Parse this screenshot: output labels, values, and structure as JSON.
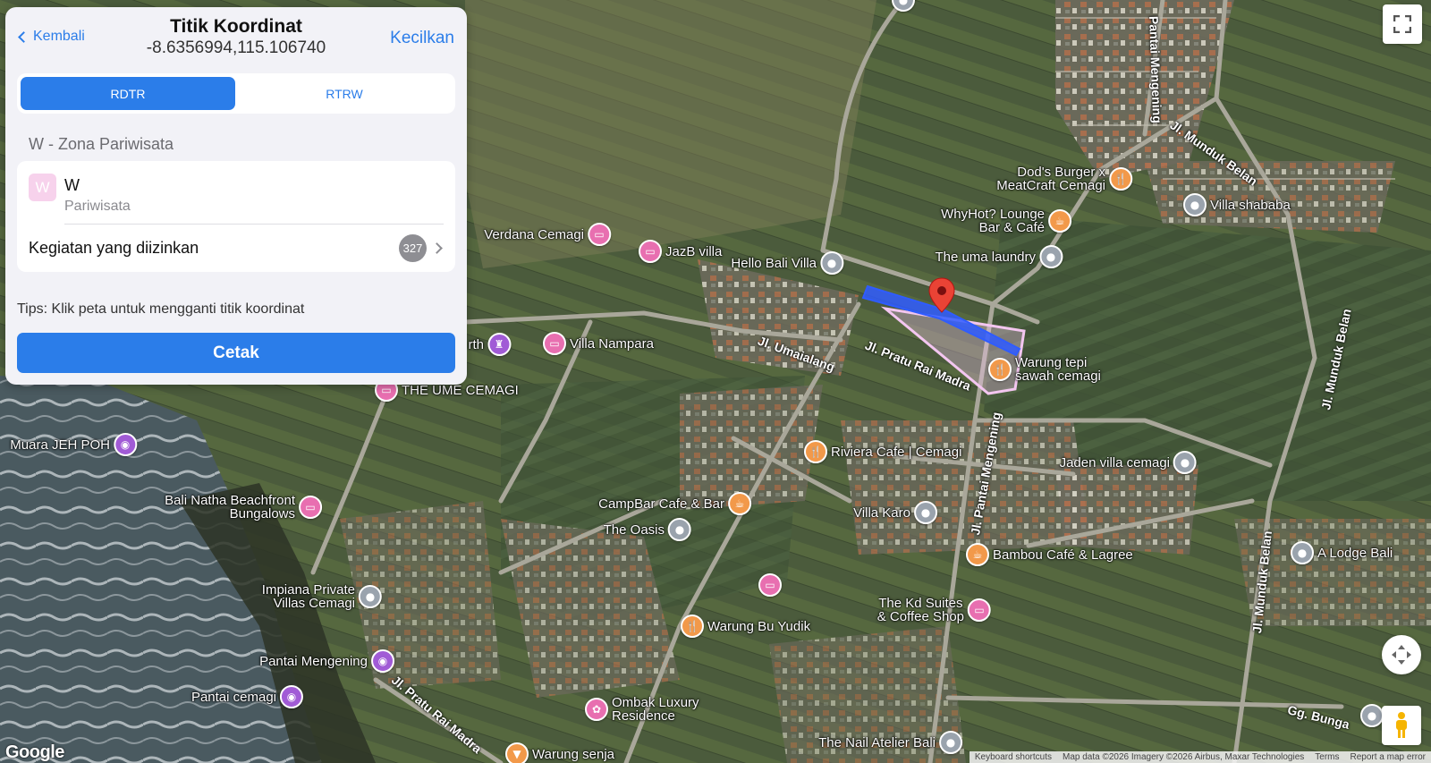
{
  "panel": {
    "back_label": "Kembali",
    "title": "Titik Koordinat",
    "coordinates": "-8.6356994,115.106740",
    "collapse_label": "Kecilkan",
    "tabs": [
      {
        "label": "RDTR",
        "active": true
      },
      {
        "label": "RTRW",
        "active": false
      }
    ],
    "zone_heading": "W - Zona Pariwisata",
    "zone": {
      "badge": "W",
      "code": "W",
      "name": "Pariwisata",
      "badge_color": "#f7d2ec"
    },
    "activities": {
      "label": "Kegiatan yang diizinkan",
      "count": "327"
    },
    "tips": "Tips: Klik peta untuk mengganti titik koordinat",
    "print_label": "Cetak"
  },
  "map": {
    "pois": [
      {
        "name": "Verdana Cemagi",
        "type": "hotel",
        "icon": "bed-icon"
      },
      {
        "name": "JazB villa",
        "type": "hotel",
        "icon": "bed-icon"
      },
      {
        "name": "Hello Bali Villa",
        "type": "place",
        "icon": "pin-icon"
      },
      {
        "name": "The uma laundry",
        "type": "place",
        "icon": "pin-icon"
      },
      {
        "name": "WhyHot? Lounge\nBar & Café",
        "type": "food",
        "icon": "cup-icon"
      },
      {
        "name": "Dod's Burger x\nMeatCraft Cemagi",
        "type": "food",
        "icon": "fork-icon"
      },
      {
        "name": "Villa shababa",
        "type": "place",
        "icon": "pin-icon"
      },
      {
        "name": "Warung tepi\nsawah cemagi",
        "type": "food",
        "icon": "fork-icon"
      },
      {
        "name": "Villa Nampara",
        "type": "hotel",
        "icon": "bed-icon"
      },
      {
        "name": "rth",
        "type": "attr",
        "icon": "chess-icon"
      },
      {
        "name": "THE UME CEMAGI",
        "type": "hotel",
        "icon": "bed-icon"
      },
      {
        "name": "Muara JEH POH",
        "type": "attr",
        "icon": "camera-icon"
      },
      {
        "name": "Bali Natha Beachfront\nBungalows",
        "type": "hotel",
        "icon": "bed-icon"
      },
      {
        "name": "Riviera Cafe | Cemagi",
        "type": "food",
        "icon": "fork-icon"
      },
      {
        "name": "Jaden villa cemagi",
        "type": "place",
        "icon": "pin-icon"
      },
      {
        "name": "CampBar Cafe & Bar",
        "type": "food",
        "icon": "cup-icon"
      },
      {
        "name": "The Oasis",
        "type": "place",
        "icon": "pin-icon"
      },
      {
        "name": "Villa Karo",
        "type": "place",
        "icon": "pin-icon"
      },
      {
        "name": "Bambou Café & Lagree",
        "type": "food",
        "icon": "cup-icon"
      },
      {
        "name": "A Lodge Bali",
        "type": "place",
        "icon": "pin-icon"
      },
      {
        "name": "Impiana Private\nVillas Cemagi",
        "type": "place",
        "icon": "pin-icon"
      },
      {
        "name": "",
        "type": "hotel",
        "icon": "bed-icon"
      },
      {
        "name": "The Kd Suites\n& Coffee Shop",
        "type": "hotel",
        "icon": "bed-icon"
      },
      {
        "name": "Warung Bu Yudik",
        "type": "food",
        "icon": "fork-icon"
      },
      {
        "name": "Pantai Mengening",
        "type": "attr",
        "icon": "camera-icon"
      },
      {
        "name": "Pantai cemagi",
        "type": "attr",
        "icon": "camera-icon"
      },
      {
        "name": "Ombak Luxury\nResidence",
        "type": "hotel",
        "icon": "spa-icon"
      },
      {
        "name": "Warung senja",
        "type": "food",
        "icon": "drink-icon"
      },
      {
        "name": "The Nail Atelier Bali",
        "type": "place",
        "icon": "pin-icon"
      },
      {
        "name": "",
        "type": "place",
        "icon": "pin-icon"
      },
      {
        "name": "",
        "type": "place",
        "icon": "pin-icon"
      }
    ],
    "roads": [
      "Jl. Umaialang",
      "Jl. Pratu Rai Madra",
      "Jl. Pantai Mengening",
      "Jl. Munduk Belan",
      "Pantai Mengening",
      "Jl. Munduk Belan",
      "Jl. Pratu Rai Madra",
      "Jl. Munduk Belan",
      "Gg. Bunga"
    ],
    "logo": "Google",
    "attribution": [
      "Keyboard shortcuts",
      "Map data ©2026 Imagery ©2026 Airbus, Maxar Technologies",
      "Terms",
      "Report a map error"
    ],
    "parcel_color": "#2f5cff",
    "zone_color": "#f3c6f0",
    "marker_color": "#ea4335"
  }
}
